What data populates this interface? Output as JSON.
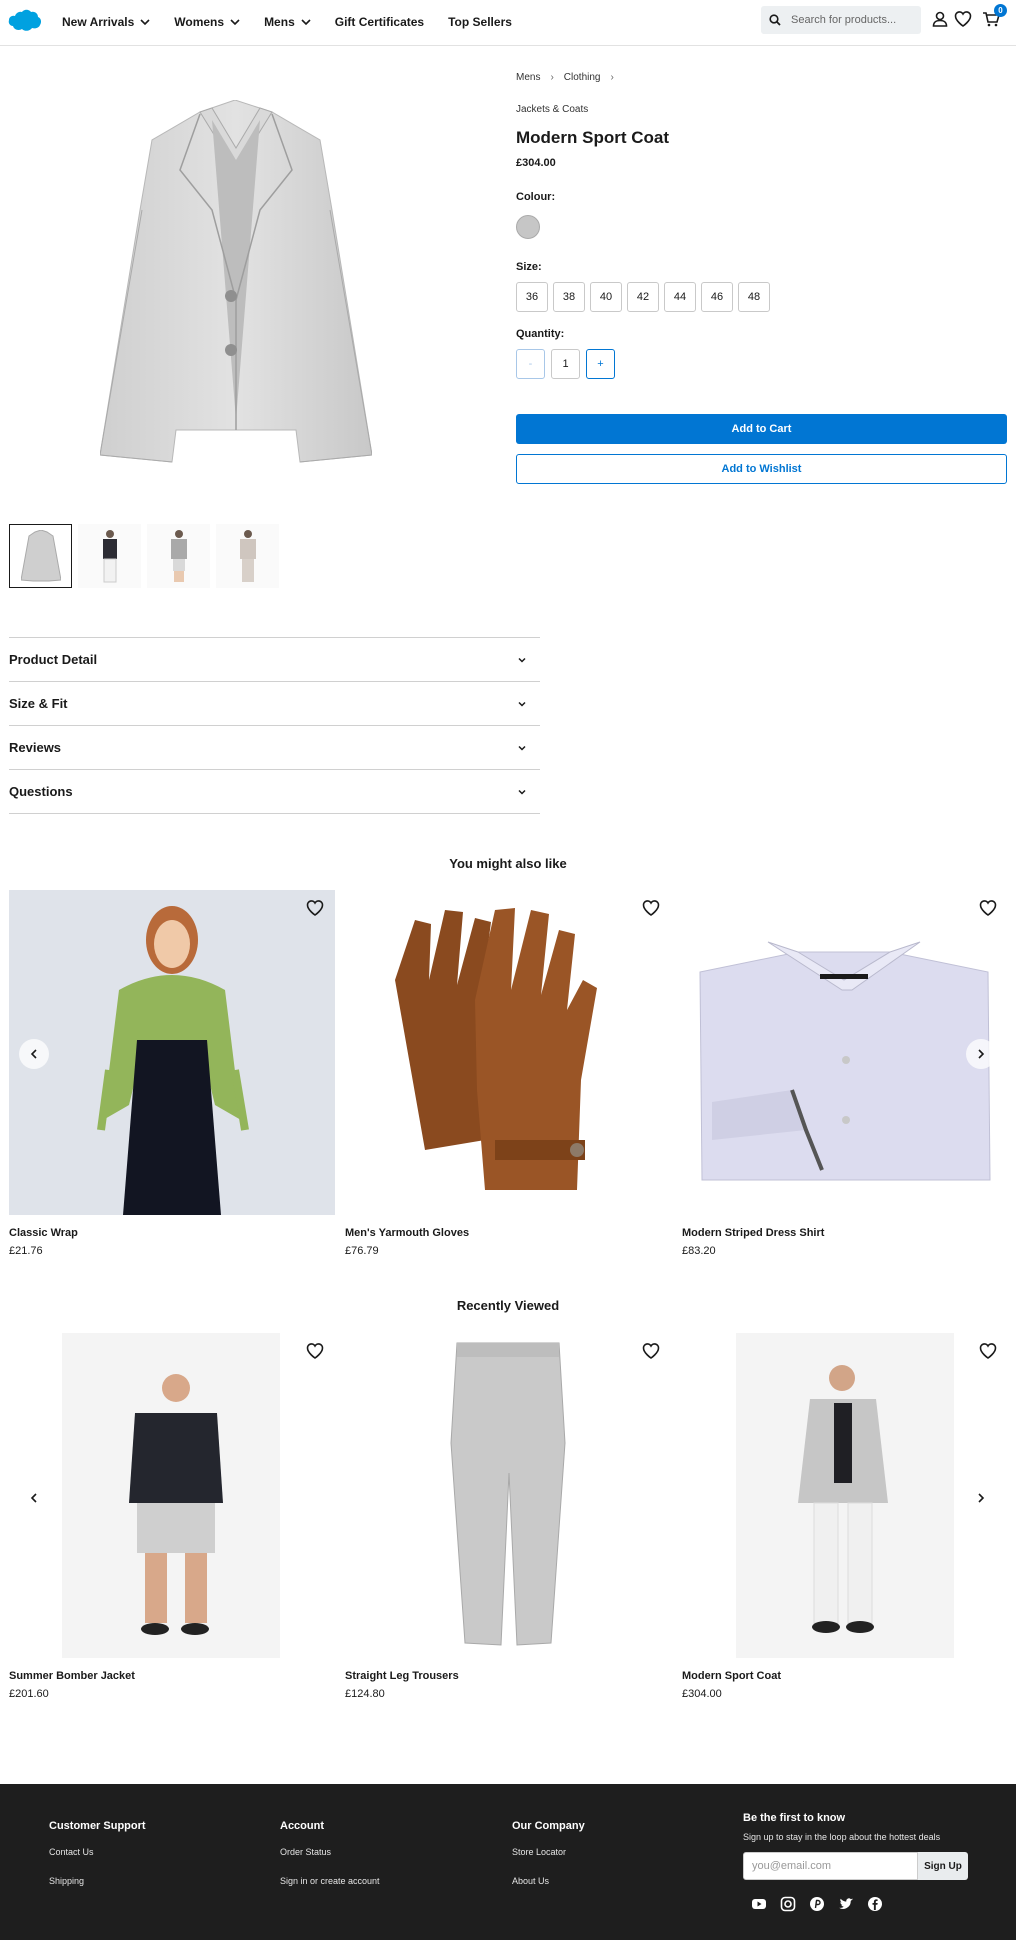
{
  "header": {
    "nav": [
      {
        "label": "New Arrivals",
        "dropdown": true
      },
      {
        "label": "Womens",
        "dropdown": true
      },
      {
        "label": "Mens",
        "dropdown": true
      },
      {
        "label": "Gift Certificates",
        "dropdown": false
      },
      {
        "label": "Top Sellers",
        "dropdown": false
      }
    ],
    "search_placeholder": "Search for products...",
    "cart_count": "0"
  },
  "product": {
    "breadcrumb": [
      "Mens",
      "Clothing"
    ],
    "category": "Jackets & Coats",
    "title": "Modern Sport Coat",
    "price": "£304.00",
    "colour_label": "Colour:",
    "colour_swatch": "#c6c6c6",
    "size_label": "Size:",
    "sizes": [
      "36",
      "38",
      "40",
      "42",
      "44",
      "46",
      "48"
    ],
    "quantity_label": "Quantity:",
    "qty_minus": "-",
    "qty_value": "1",
    "qty_plus": "+",
    "add_to_cart": "Add to Cart",
    "add_to_wishlist": "Add to Wishlist"
  },
  "accordion": [
    "Product Detail",
    "Size & Fit",
    "Reviews",
    "Questions"
  ],
  "recommendations": {
    "title": "You might also like",
    "items": [
      {
        "name": "Classic Wrap",
        "price": "£21.76"
      },
      {
        "name": "Men's Yarmouth Gloves",
        "price": "£76.79"
      },
      {
        "name": "Modern Striped Dress Shirt",
        "price": "£83.20"
      }
    ]
  },
  "recently_viewed": {
    "title": "Recently Viewed",
    "items": [
      {
        "name": "Summer Bomber Jacket",
        "price": "£201.60"
      },
      {
        "name": "Straight Leg Trousers",
        "price": "£124.80"
      },
      {
        "name": "Modern Sport Coat",
        "price": "£304.00"
      }
    ]
  },
  "footer": {
    "columns": [
      {
        "heading": "Customer Support",
        "links": [
          "Contact Us",
          "Shipping"
        ]
      },
      {
        "heading": "Account",
        "links": [
          "Order Status",
          "Sign in or create account"
        ]
      },
      {
        "heading": "Our Company",
        "links": [
          "Store Locator",
          "About Us"
        ]
      }
    ],
    "newsletter": {
      "heading": "Be the first to know",
      "subtext": "Sign up to stay in the loop about the hottest deals",
      "placeholder": "you@email.com",
      "button": "Sign Up"
    },
    "socials": [
      "youtube-icon",
      "instagram-icon",
      "pinterest-icon",
      "twitter-icon",
      "facebook-icon"
    ]
  },
  "colors": {
    "brand_blue": "#0176d3",
    "footer_bg": "#1e1e1e"
  }
}
